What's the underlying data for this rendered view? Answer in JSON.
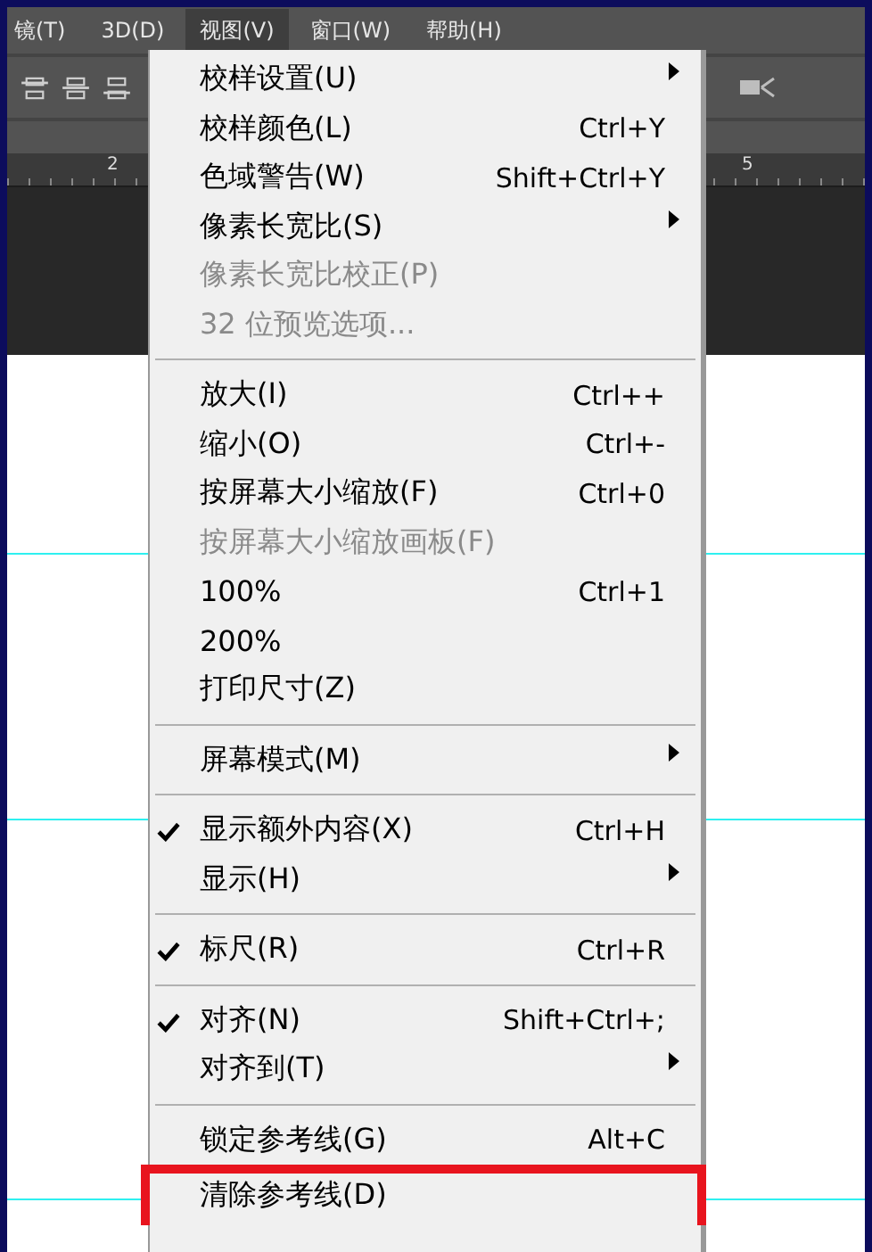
{
  "menubar": [
    {
      "label": "镜(T)",
      "selected": false
    },
    {
      "label": "3D(D)",
      "selected": false
    },
    {
      "label": "视图(V)",
      "selected": true
    },
    {
      "label": "窗口(W)",
      "selected": false
    },
    {
      "label": "帮助(H)",
      "selected": false
    }
  ],
  "ruler": {
    "labels": [
      "2",
      "5"
    ]
  },
  "menu": {
    "sections": [
      {
        "items": [
          {
            "label": "校样设置(U)",
            "submenu": true,
            "checked": false,
            "disabled": false
          },
          {
            "label": "校样颜色(L)",
            "shortcut": "Ctrl+Y",
            "submenu": false,
            "checked": false,
            "disabled": false
          },
          {
            "label": "色域警告(W)",
            "shortcut": "Shift+Ctrl+Y",
            "submenu": false,
            "checked": false,
            "disabled": false
          },
          {
            "label": "像素长宽比(S)",
            "submenu": true,
            "checked": false,
            "disabled": false
          },
          {
            "label": "像素长宽比校正(P)",
            "submenu": false,
            "checked": false,
            "disabled": true
          },
          {
            "label": "32 位预览选项...",
            "submenu": false,
            "checked": false,
            "disabled": true
          }
        ]
      },
      {
        "items": [
          {
            "label": "放大(I)",
            "shortcut": "Ctrl++",
            "submenu": false,
            "checked": false,
            "disabled": false
          },
          {
            "label": "缩小(O)",
            "shortcut": "Ctrl+-",
            "submenu": false,
            "checked": false,
            "disabled": false
          },
          {
            "label": "按屏幕大小缩放(F)",
            "shortcut": "Ctrl+0",
            "submenu": false,
            "checked": false,
            "disabled": false
          },
          {
            "label": "按屏幕大小缩放画板(F)",
            "submenu": false,
            "checked": false,
            "disabled": true
          },
          {
            "label": "100%",
            "shortcut": "Ctrl+1",
            "submenu": false,
            "checked": false,
            "disabled": false
          },
          {
            "label": "200%",
            "submenu": false,
            "checked": false,
            "disabled": false
          },
          {
            "label": "打印尺寸(Z)",
            "submenu": false,
            "checked": false,
            "disabled": false
          }
        ]
      },
      {
        "items": [
          {
            "label": "屏幕模式(M)",
            "submenu": true,
            "checked": false,
            "disabled": false
          }
        ]
      },
      {
        "items": [
          {
            "label": "显示额外内容(X)",
            "shortcut": "Ctrl+H",
            "submenu": false,
            "checked": true,
            "disabled": false
          },
          {
            "label": "显示(H)",
            "submenu": true,
            "checked": false,
            "disabled": false
          }
        ]
      },
      {
        "items": [
          {
            "label": "标尺(R)",
            "shortcut": "Ctrl+R",
            "submenu": false,
            "checked": true,
            "disabled": false
          }
        ]
      },
      {
        "items": [
          {
            "label": "对齐(N)",
            "shortcut": "Shift+Ctrl+;",
            "submenu": false,
            "checked": true,
            "disabled": false
          },
          {
            "label": "对齐到(T)",
            "submenu": true,
            "checked": false,
            "disabled": false
          }
        ]
      },
      {
        "items": [
          {
            "label": "锁定参考线(G)",
            "shortcut": "Alt+C",
            "submenu": false,
            "checked": false,
            "disabled": false
          },
          {
            "label": "清除参考线(D)",
            "submenu": false,
            "checked": false,
            "disabled": false,
            "annotated": true
          }
        ]
      }
    ]
  }
}
